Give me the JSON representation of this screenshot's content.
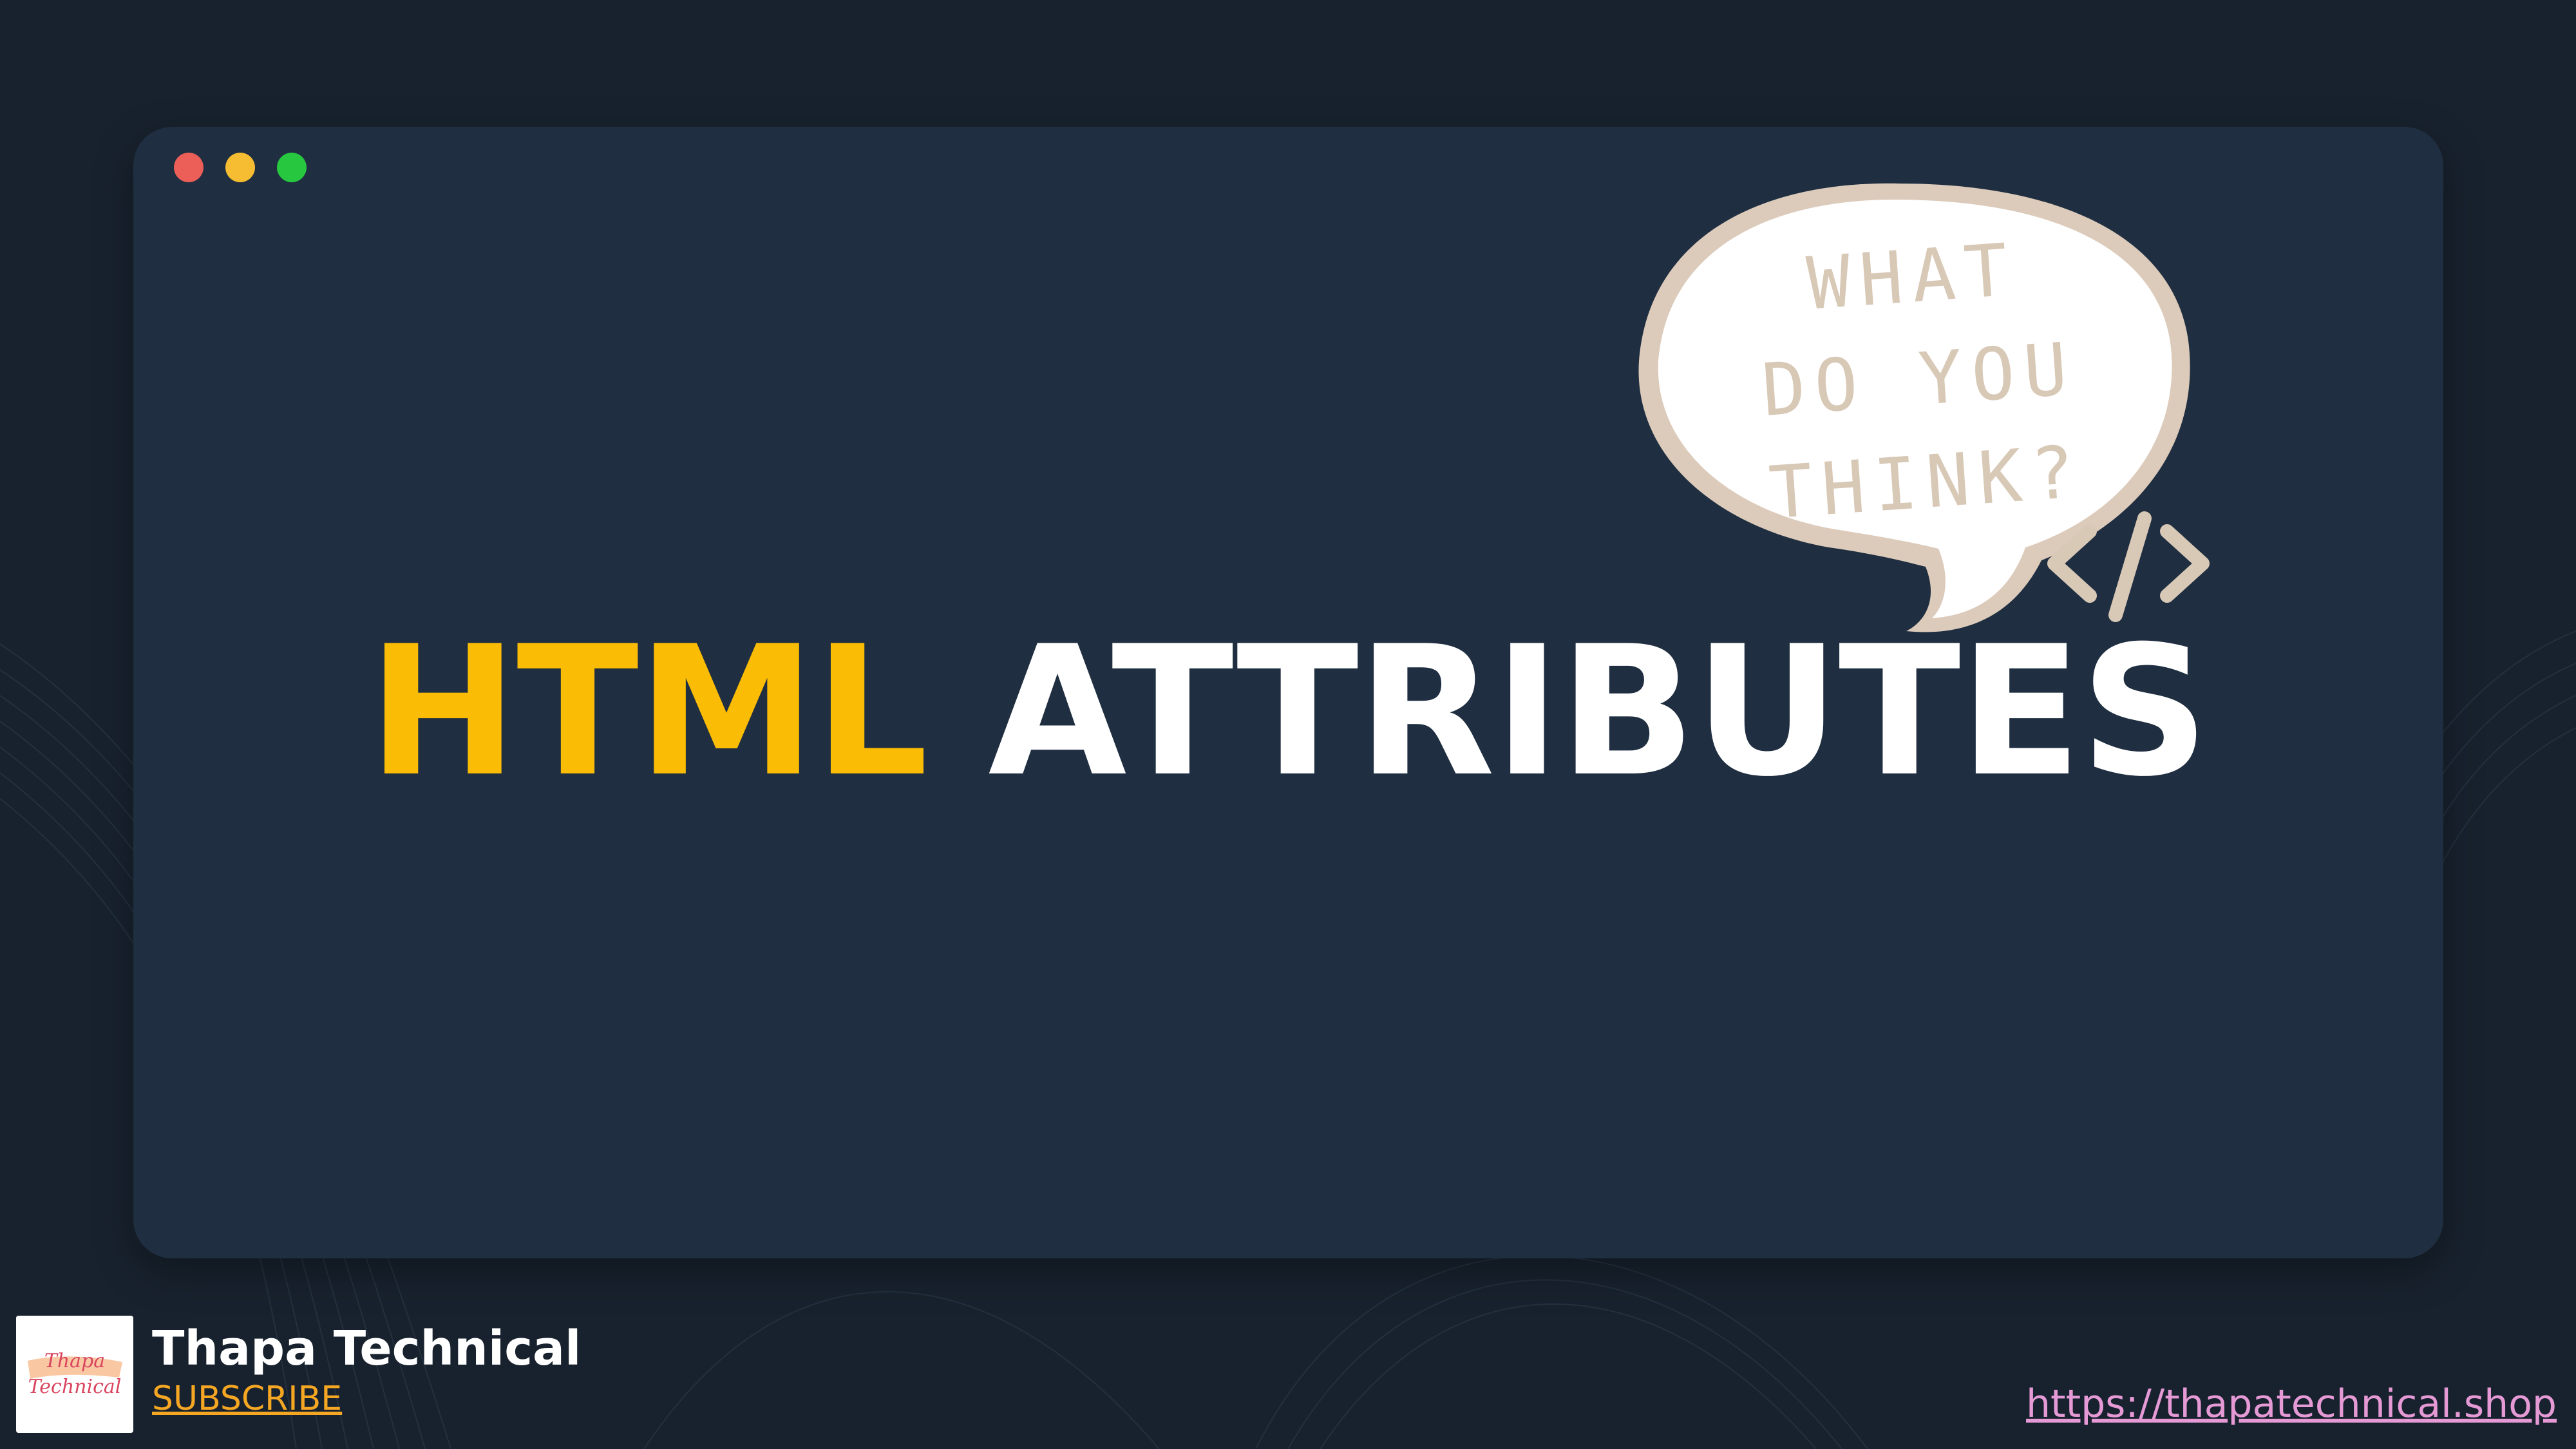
{
  "headline": {
    "accent": "HTML",
    "main": "ATTRIBUTES"
  },
  "bubble": {
    "lines": [
      "WHAT",
      "DO YOU",
      "THINK?"
    ]
  },
  "window_controls": {
    "close_color": "#ec5f58",
    "minimize_color": "#f7bd32",
    "maximize_color": "#27c840"
  },
  "brand": {
    "name": "Thapa Technical",
    "subscribe_label": "SUBSCRIBE",
    "logo_text_1": "Thapa",
    "logo_text_2": "Technical"
  },
  "site": {
    "url_text": "https://thapatechnical.shop"
  },
  "icons": {
    "code": "code-brackets-icon",
    "speech": "speech-bubble-icon"
  },
  "colors": {
    "page_background": "#18222e",
    "window_background": "#1f2e40",
    "accent_yellow": "#fbbc05",
    "bubble_fill": "#ffffff",
    "bubble_outline": "#dccbbb",
    "link_pink": "#e59ad6",
    "subscribe_orange": "#f5a623"
  }
}
